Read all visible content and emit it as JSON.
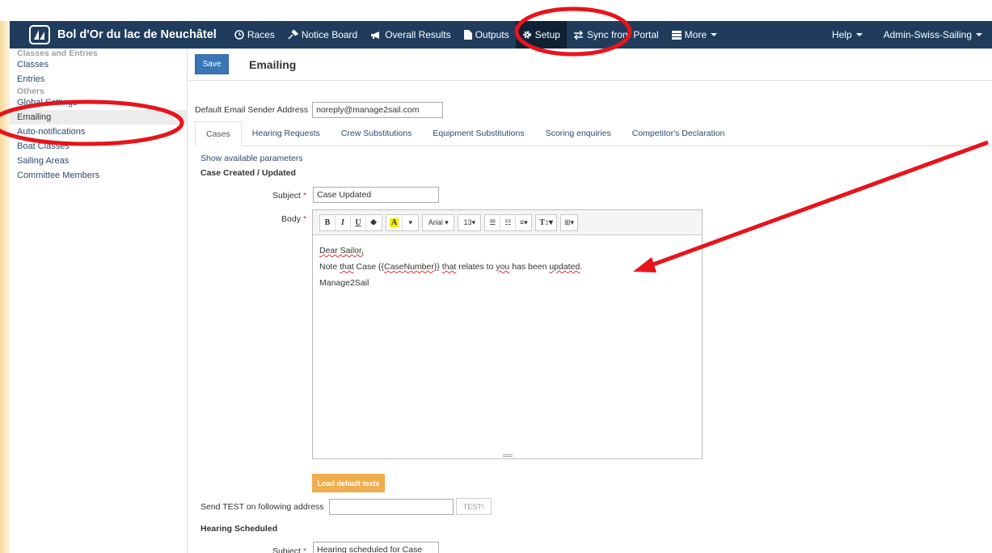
{
  "navbar": {
    "brand_title": "Bol d'Or du lac de Neuchâtel",
    "items": [
      {
        "label": "Races",
        "icon": "clock-icon"
      },
      {
        "label": "Notice Board",
        "icon": "pin-icon"
      },
      {
        "label": "Overall Results",
        "icon": "bullhorn-icon"
      },
      {
        "label": "Outputs",
        "icon": "file-icon"
      },
      {
        "label": "Setup",
        "icon": "gear-icon"
      },
      {
        "label": "Sync from Portal",
        "icon": "sync-icon"
      },
      {
        "label": "More",
        "icon": "menu-icon"
      }
    ],
    "help": "Help",
    "user": "Admin-Swiss-Sailing"
  },
  "sidebar": {
    "section1": "Classes and Entries",
    "items1": [
      "Classes",
      "Entries"
    ],
    "section2": "Others",
    "items2": [
      "Global Settings",
      "Emailing",
      "Auto-notifications",
      "Boat Classes",
      "Sailing Areas",
      "Committee Members"
    ]
  },
  "page": {
    "save_label": "Save",
    "title": "Emailing",
    "sender_label": "Default Email Sender Address",
    "sender_value": "noreply@manage2sail.com",
    "tabs": [
      "Cases",
      "Hearing Requests",
      "Crew Substitutions",
      "Equipment Substitutions",
      "Scoring enquiries",
      "Competitor's Declaration"
    ],
    "show_params": "Show available parameters",
    "section1_title": "Case Created / Updated",
    "subject_label": "Subject",
    "subject_value": "Case Updated",
    "body_label": "Body",
    "required_mark": "*",
    "toolbar": {
      "font": "Arial",
      "size": "13"
    },
    "body": {
      "line1": "Dear Sailor,",
      "line2_a": "Note ",
      "line2_b": "that",
      "line2_c": " Case {{",
      "line2_d": "CaseNumber",
      "line2_e": "}} ",
      "line2_f": "that",
      "line2_g": " relates to ",
      "line2_h": "you",
      "line2_i": " has been ",
      "line2_j": "updated",
      "line2_k": ".",
      "line3": "Manage2Sail"
    },
    "load_defaults": "Load default texts",
    "test_label": "Send TEST on following address",
    "test_value": "",
    "test_button": "TEST!",
    "section2_title": "Hearing Scheduled",
    "subject2_value": "Hearing scheduled for Case"
  },
  "colors": {
    "navbar": "#1f3c5c",
    "save": "#3a76b5",
    "load": "#f0ad4e",
    "annotation": "#e8141b"
  }
}
